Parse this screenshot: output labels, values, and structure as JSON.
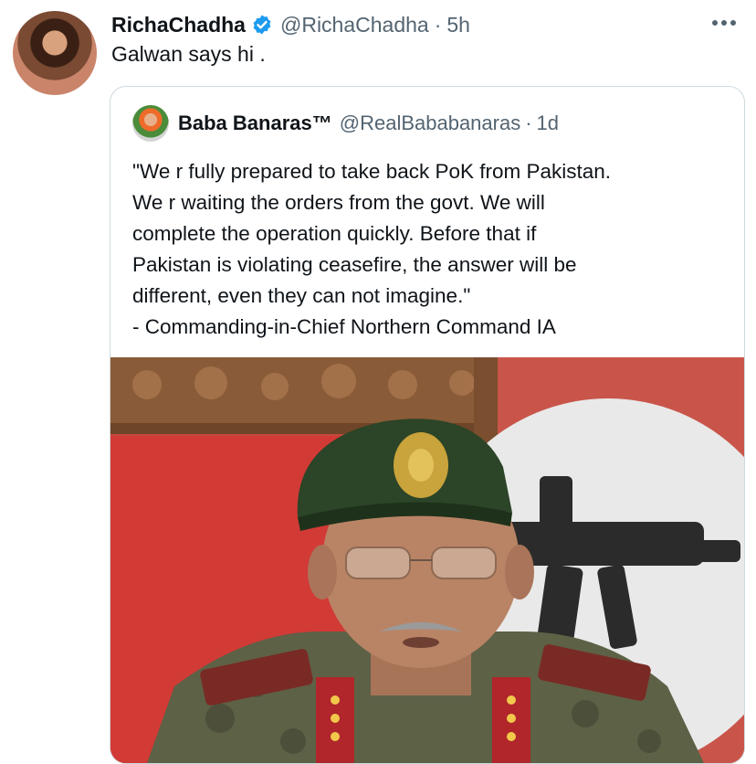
{
  "tweet": {
    "display_name": "RichaChadha",
    "handle": "@RichaChadha",
    "separator": "·",
    "time": "5h",
    "text": "Galwan says hi .",
    "avatar_icon": "profile-photo",
    "verified_icon": "verified-badge-icon",
    "more_icon": "more-options-icon"
  },
  "quote": {
    "display_name": "Baba Banaras™",
    "handle": "@RealBababanaras",
    "separator": "·",
    "time": "1d",
    "text": "\"We r fully prepared to take back PoK from Pakistan.\nWe r waiting the orders from the govt. We will\ncomplete the operation quickly. Before that if\nPakistan is violating ceasefire, the answer will be\ndifferent, even they can not imagine.\"\n- Commanding-in-Chief Northern Command IA",
    "avatar_icon": "profile-photo",
    "media": "photo-army-officer"
  },
  "colors": {
    "text": "#0f1419",
    "secondary": "#536471",
    "verified": "#1d9bf0",
    "border": "#cfd9de"
  }
}
